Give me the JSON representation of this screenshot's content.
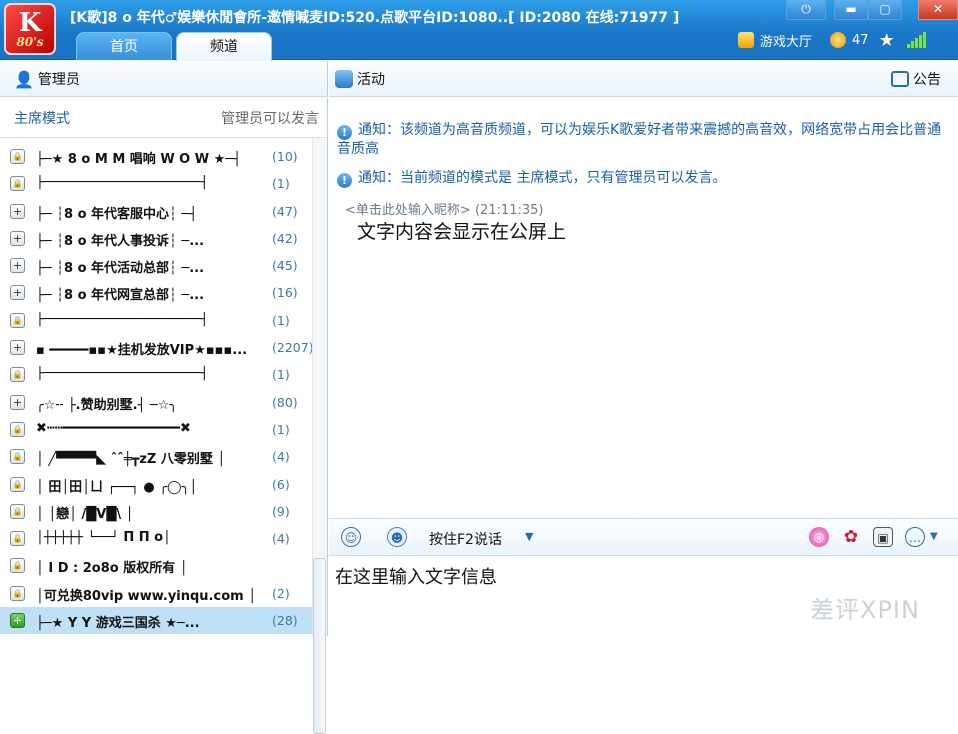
{
  "window": {
    "title": "[K歌]8 o 年代♂娱樂休閒會所-邀情喊麦ID:520.点歌平台ID:1080..[ ID:2080 在线:71977 ]",
    "logo_text": "K",
    "logo_sub": "80's"
  },
  "tabs": [
    {
      "label": "首页"
    },
    {
      "label": "频道"
    }
  ],
  "status": {
    "game_hall": "游戏大厅",
    "coins": "47"
  },
  "left_bar": {
    "label": "管理员"
  },
  "right_bar": {
    "label": "活动",
    "announce": "公告"
  },
  "mode": {
    "left": "主席模式",
    "right": "管理员可以发言"
  },
  "channels": [
    {
      "icon": "lock",
      "name": "├─★ 8 o M M 唱响 W O W ★─┤",
      "count": "(10)"
    },
    {
      "icon": "lock",
      "name": "├────────────────────┤",
      "count": "(1)"
    },
    {
      "icon": "plus",
      "name": "├─  ┆8 o 年代客服中心┆  ─┤",
      "count": "(47)"
    },
    {
      "icon": "plus",
      "name": "├─  ┆8 o 年代人事投诉┆  ─...",
      "count": "(42)"
    },
    {
      "icon": "plus",
      "name": "├─  ┆8 o 年代活动总部┆  ─...",
      "count": "(45)"
    },
    {
      "icon": "plus",
      "name": "├─  ┆8 o 年代网宣总部┆  ─...",
      "count": "(16)"
    },
    {
      "icon": "lock",
      "name": "├────────────────────┤",
      "count": "(1)"
    },
    {
      "icon": "plus",
      "name": "▪ ━━━━━▪▪★挂机发放VIP★▪▪▪...",
      "count": "(2207)"
    },
    {
      "icon": "lock",
      "name": "├────────────────────┤",
      "count": "(1)"
    },
    {
      "icon": "plus",
      "name": "╭☆╌    ├.赞助别墅.┤     ─☆╮",
      "count": "(80)"
    },
    {
      "icon": "lock",
      "name": "✖┅┅━━━━━━━━━━━━━━━✖",
      "count": "(1)"
    },
    {
      "icon": "lock",
      "name": "│ ╱▀▀▀▀◣ ˆˆ╪┳zZ   八零别墅   │",
      "count": "(4)"
    },
    {
      "icon": "lock",
      "name": "│ 田│田│ㄩ      ┌──┐  ●  ╭◯╮│",
      "count": "(6)"
    },
    {
      "icon": "lock",
      "name": "│                │戀│ /█V█\\  │",
      "count": "(9)"
    },
    {
      "icon": "lock",
      "name": "│┼┼┼┼┼     └──┘  Π   Π o│",
      "count": "(4)"
    },
    {
      "icon": "lock",
      "name": "│ I D  :  2o8o     版权所有 │",
      "count": ""
    },
    {
      "icon": "lock",
      "name": "│可兑换80vip   www.yinqu.com  │",
      "count": "(2)"
    },
    {
      "icon": "plus",
      "name": "├─★    Y Y 游戏三国杀    ★─...",
      "count": "(28)"
    }
  ],
  "notices": [
    {
      "text": "通知：该频道为高音质频道，可以为娱乐K歌爱好者带来震撼的高音效，网络宽带占用会比普通音质高"
    },
    {
      "text": "通知：当前频道的模式是 主席模式，只有管理员可以发言。"
    }
  ],
  "message": {
    "nickname": "<单击此处输入昵称>",
    "time": "(21:11:35)",
    "text": "文字内容会显示在公屏上"
  },
  "input_toolbar": {
    "f2_label": "按住F2说话"
  },
  "input": {
    "text": "在这里输入文字信息"
  },
  "watermark": "差评XPIN",
  "colors": {
    "title_bar": "#1a78c8",
    "notice_text": "#1b5fa8",
    "selected_row": "#bfe0f6",
    "count_text": "#3b76b9"
  }
}
